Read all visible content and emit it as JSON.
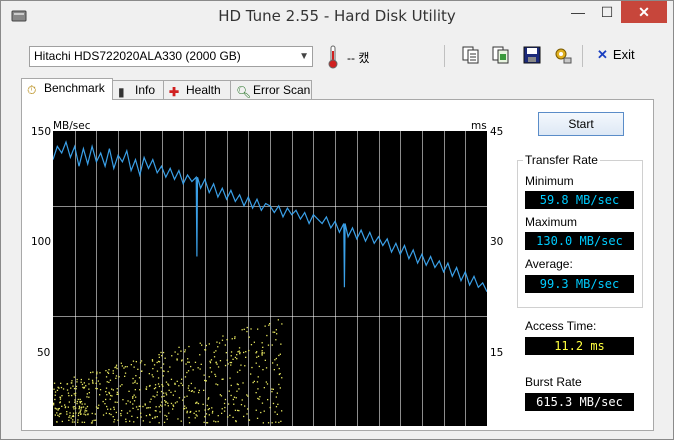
{
  "window": {
    "title": "HD Tune 2.55 - Hard Disk Utility",
    "minimize": "—",
    "maximize": "☐",
    "close": "✕"
  },
  "toolbar": {
    "drive": "Hitachi HDS722020ALA330 (2000 GB)",
    "temperature": "-- 캤",
    "exit_label": "Exit"
  },
  "tabs": [
    {
      "label": "Benchmark",
      "icon": "stopwatch-icon"
    },
    {
      "label": "Info",
      "icon": "info-icon"
    },
    {
      "label": "Health",
      "icon": "health-cross-icon"
    },
    {
      "label": "Error Scan",
      "icon": "magnifier-icon"
    }
  ],
  "benchmark": {
    "start_label": "Start",
    "transfer_rate_title": "Transfer Rate",
    "minimum_label": "Minimum",
    "minimum_value": "59.8 MB/sec",
    "maximum_label": "Maximum",
    "maximum_value": "130.0 MB/sec",
    "average_label": "Average:",
    "average_value": "99.3 MB/sec",
    "access_time_label": "Access Time:",
    "access_time_value": "11.2 ms",
    "burst_rate_label": "Burst Rate",
    "burst_rate_value": "615.3 MB/sec"
  },
  "colors": {
    "chart_bg": "#000000",
    "grid": "#ffffff",
    "transfer_line": "#3aa0e8",
    "access_dots": "#e8e860",
    "value_text": "#00ccff",
    "access_text": "#ffff40",
    "burst_text": "#ffffff"
  },
  "chart_data": {
    "type": "line",
    "ylabel_left": "MB/sec",
    "ylabel_right": "ms",
    "left_ticks": [
      "150",
      "100",
      "50"
    ],
    "right_ticks": [
      "45",
      "30",
      "15"
    ],
    "ylim_left": [
      0,
      150
    ],
    "ylim_right": [
      0,
      45
    ],
    "xlim": [
      0,
      100
    ],
    "grid": true,
    "series": [
      {
        "name": "transfer-rate",
        "x": [
          0,
          1,
          2,
          3,
          4,
          5,
          6,
          7,
          8,
          9,
          10,
          11,
          12,
          13,
          14,
          15,
          16,
          17,
          18,
          19,
          20,
          21,
          22,
          23,
          24,
          25,
          26,
          27,
          28,
          29,
          30,
          31,
          32,
          33,
          34,
          35,
          36,
          37,
          38,
          39,
          40,
          41,
          42,
          43,
          44,
          45,
          46,
          47,
          48,
          49,
          50,
          51,
          52,
          53,
          54,
          55,
          56,
          57,
          58,
          59,
          60,
          61,
          62,
          63,
          64,
          65,
          66,
          67,
          68,
          69,
          70,
          71,
          72,
          73,
          74,
          75,
          76,
          77,
          78,
          79,
          80,
          81,
          82,
          83,
          84,
          85,
          86,
          87,
          88,
          89,
          90,
          91,
          92,
          93,
          94,
          95,
          96,
          97,
          98,
          99,
          100
        ],
        "values": [
          121,
          127,
          124,
          129,
          122,
          127,
          118,
          126,
          119,
          127,
          120,
          124,
          118,
          126,
          117,
          123,
          120,
          125,
          116,
          121,
          114,
          122,
          117,
          121,
          115,
          118,
          113,
          117,
          112,
          116,
          110,
          114,
          111,
          113,
          108,
          112,
          106,
          110,
          104,
          108,
          103,
          107,
          102,
          105,
          100,
          104,
          99,
          103,
          98,
          101,
          100,
          97,
          100,
          95,
          99,
          96,
          98,
          94,
          97,
          92,
          96,
          94,
          92,
          95,
          90,
          93,
          88,
          92,
          86,
          90,
          85,
          89,
          84,
          88,
          83,
          86,
          82,
          85,
          79,
          83,
          78,
          82,
          76,
          80,
          74,
          78,
          73,
          77,
          72,
          75,
          70,
          74,
          68,
          72,
          66,
          70,
          64,
          68,
          63,
          65,
          61
        ],
        "dips": [
          {
            "x": 33,
            "value": 77
          },
          {
            "x": 67,
            "value": 63
          }
        ]
      }
    ],
    "scatter": {
      "name": "access-time",
      "axis": "right",
      "value_range_ms": [
        0.5,
        15
      ],
      "x_range": [
        0,
        53
      ]
    }
  }
}
